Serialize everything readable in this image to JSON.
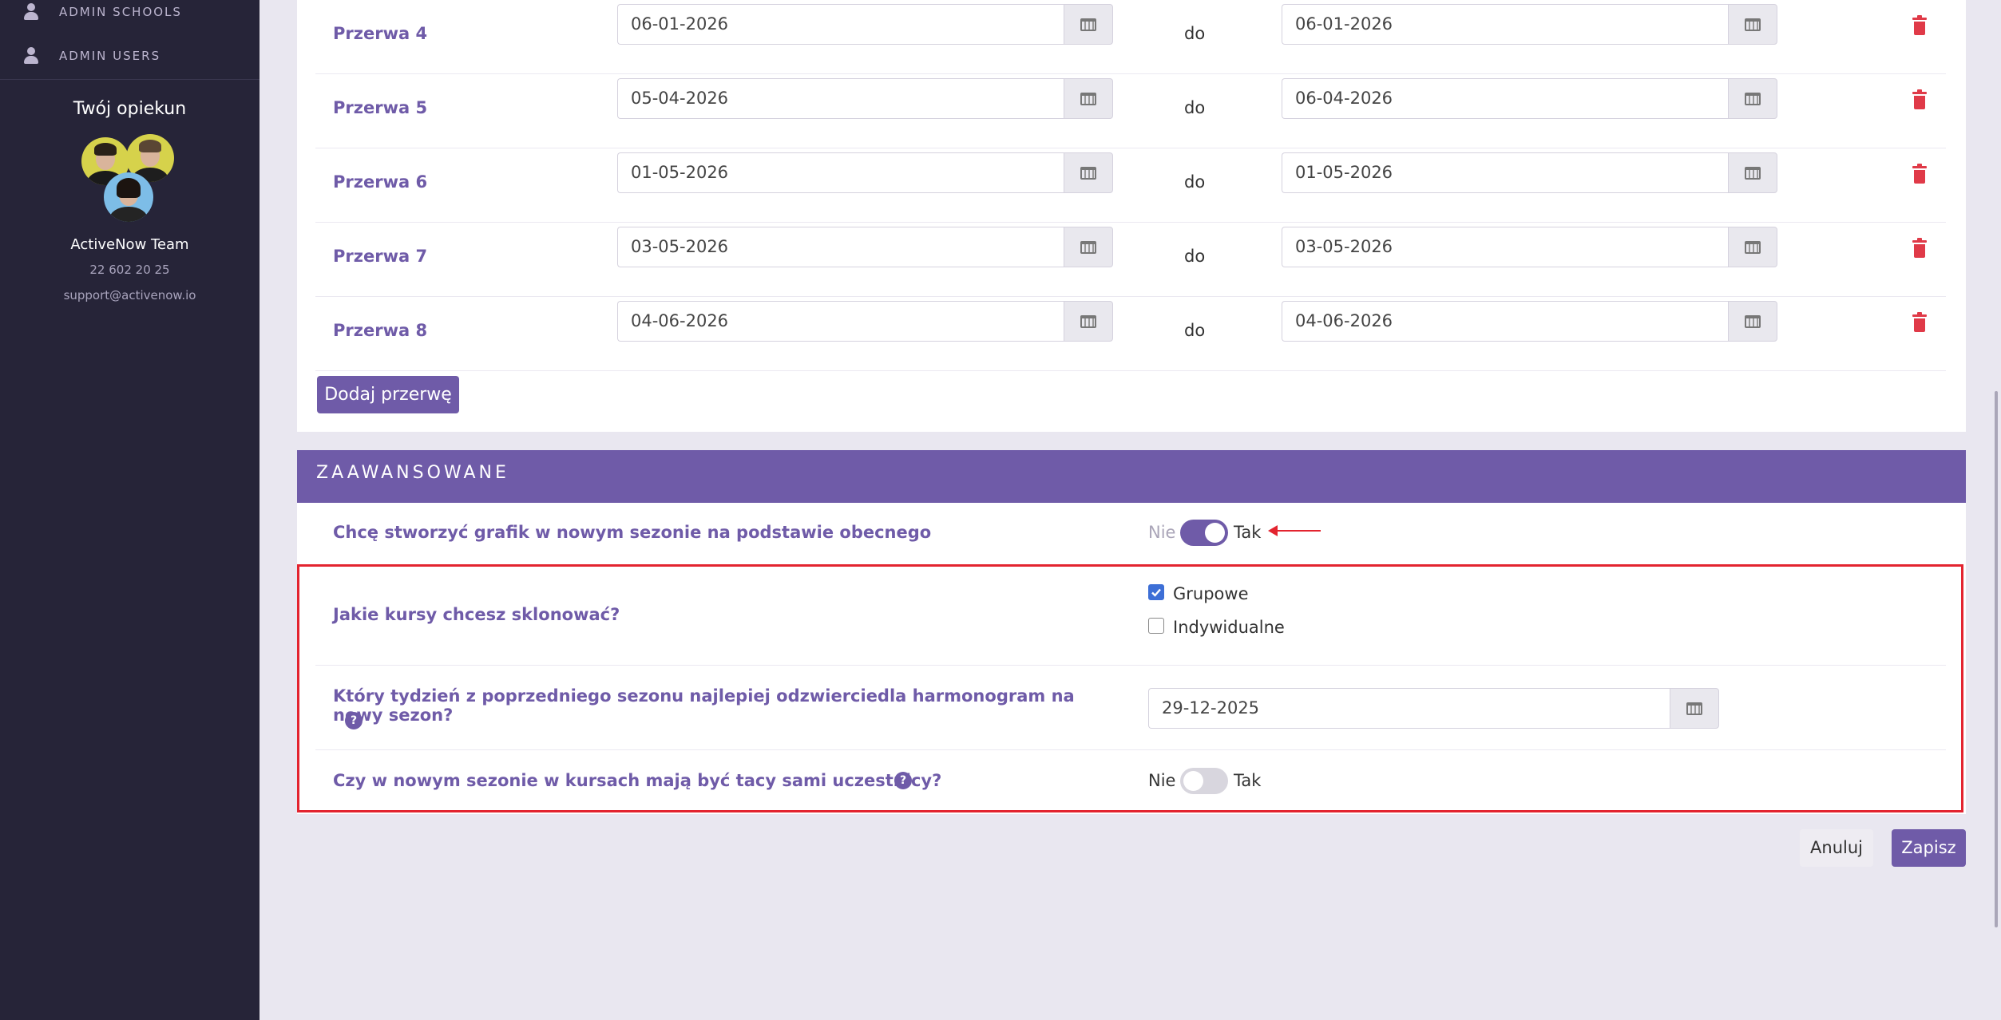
{
  "sidebar": {
    "nav": [
      {
        "label": "ADMIN SCHOOLS",
        "icon": "user-icon"
      },
      {
        "label": "ADMIN USERS",
        "icon": "user-icon"
      }
    ],
    "opiekun_title": "Twój opiekun",
    "team_name": "ActiveNow Team",
    "phone": "22 602 20 25",
    "email": "support@activenow.io"
  },
  "breaks": [
    {
      "label": "Przerwa 4",
      "from": "06-01-2026",
      "to_word": "do",
      "to": "06-01-2026"
    },
    {
      "label": "Przerwa 5",
      "from": "05-04-2026",
      "to_word": "do",
      "to": "06-04-2026"
    },
    {
      "label": "Przerwa 6",
      "from": "01-05-2026",
      "to_word": "do",
      "to": "01-05-2026"
    },
    {
      "label": "Przerwa 7",
      "from": "03-05-2026",
      "to_word": "do",
      "to": "03-05-2026"
    },
    {
      "label": "Przerwa 8",
      "from": "04-06-2026",
      "to_word": "do",
      "to": "04-06-2026"
    }
  ],
  "add_break_label": "Dodaj przerwę",
  "advanced": {
    "title": "ZAAWANSOWANE",
    "clone_schedule": {
      "question": "Chcę stworzyć grafik w nowym sezonie na podstawie obecnego",
      "off_label": "Nie",
      "on_label": "Tak",
      "enabled": true
    },
    "courses": {
      "question": "Jakie kursy chcesz sklonować?",
      "options": [
        {
          "label": "Grupowe",
          "checked": true
        },
        {
          "label": "Indywidualne",
          "checked": false
        }
      ]
    },
    "week": {
      "question": "Który tydzień z poprzedniego sezonu najlepiej odzwierciedla harmonogram na nowy sezon?",
      "help": "?",
      "value": "29-12-2025"
    },
    "participants": {
      "question": "Czy w nowym sezonie w kursach mają być tacy sami uczestnicy?",
      "help": "?",
      "off_label": "Nie",
      "on_label": "Tak",
      "enabled": false
    }
  },
  "actions": {
    "cancel": "Anuluj",
    "save": "Zapisz"
  },
  "colors": {
    "accent": "#6f5ba8",
    "sidebar_bg": "#262438",
    "page_bg": "#e9e7f0",
    "danger": "#e03a48",
    "highlight_red": "#e3242f",
    "toggle_off": "#d8d6de"
  }
}
